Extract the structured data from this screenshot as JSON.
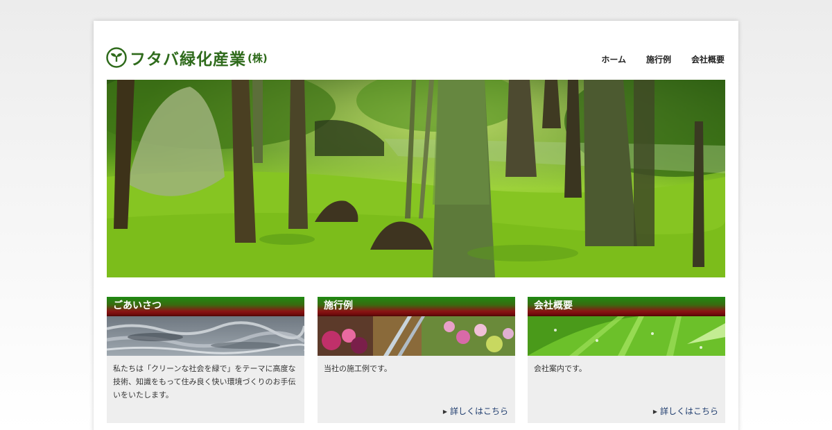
{
  "header": {
    "logo_text": "フタバ緑化産業",
    "logo_suffix": "(株)",
    "nav": [
      "ホーム",
      "施行例",
      "会社概要"
    ]
  },
  "cards": [
    {
      "title": "ごあいさつ",
      "text": "私たちは「クリーンな社会を緑で」をテーマに高度な技術、知識をもって住み良く快い環境づくりのお手伝いをいたします。",
      "link": ""
    },
    {
      "title": "施行例",
      "text": "当社の施工例です。",
      "link": "詳しくはこちら"
    },
    {
      "title": "会社概要",
      "text": "会社案内です。",
      "link": "詳しくはこちら"
    }
  ],
  "colors": {
    "brand_green": "#2f6b1c",
    "header_gradient_top": "#1e8a12",
    "header_gradient_bottom": "#8a1414",
    "link": "#1e3c6e"
  }
}
